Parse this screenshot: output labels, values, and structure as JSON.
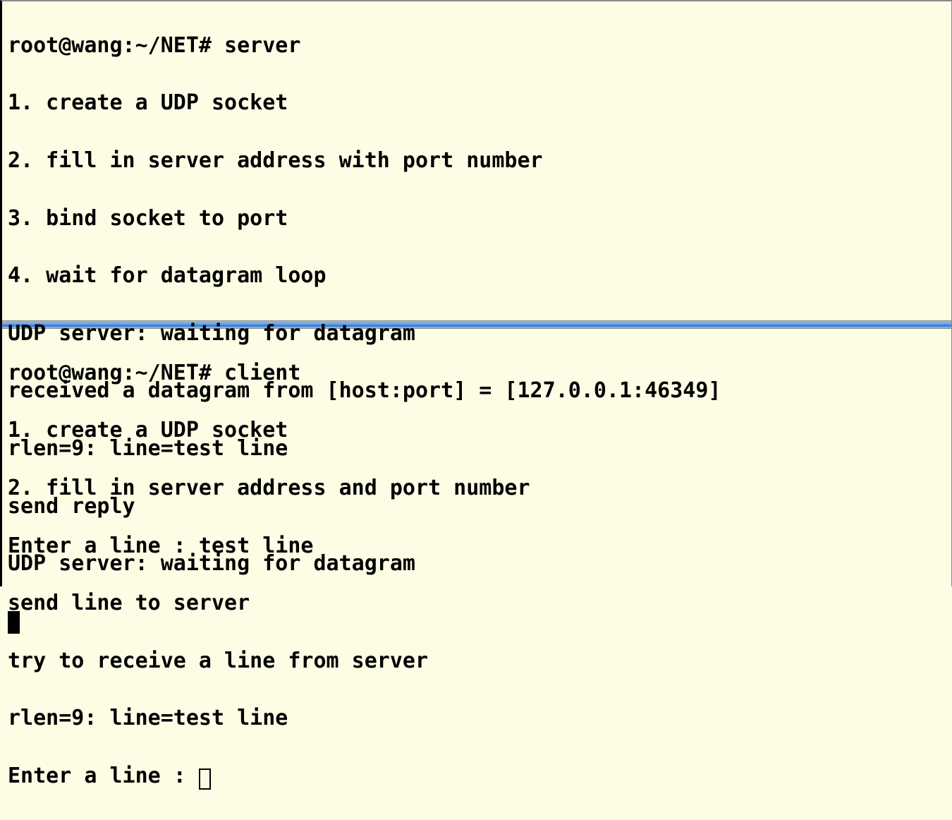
{
  "top": {
    "prompt": "root@wang:~/NET# ",
    "command": "server",
    "lines": [
      "1. create a UDP socket",
      "2. fill in server address with port number",
      "3. bind socket to port",
      "4. wait for datagram loop",
      "UDP server: waiting for datagram",
      "received a datagram from [host:port] = [127.0.0.1:46349]",
      "rlen=9: line=test line",
      "send reply",
      "UDP server: waiting for datagram"
    ]
  },
  "bottom": {
    "prompt": "root@wang:~/NET# ",
    "command": "client",
    "lines": [
      "1. create a UDP socket",
      "2. fill in server address and port number",
      "Enter a line : test line",
      "send line to server",
      "try to receive a line from server",
      "rlen=9: line=test line"
    ],
    "input_prompt": "Enter a line : "
  }
}
